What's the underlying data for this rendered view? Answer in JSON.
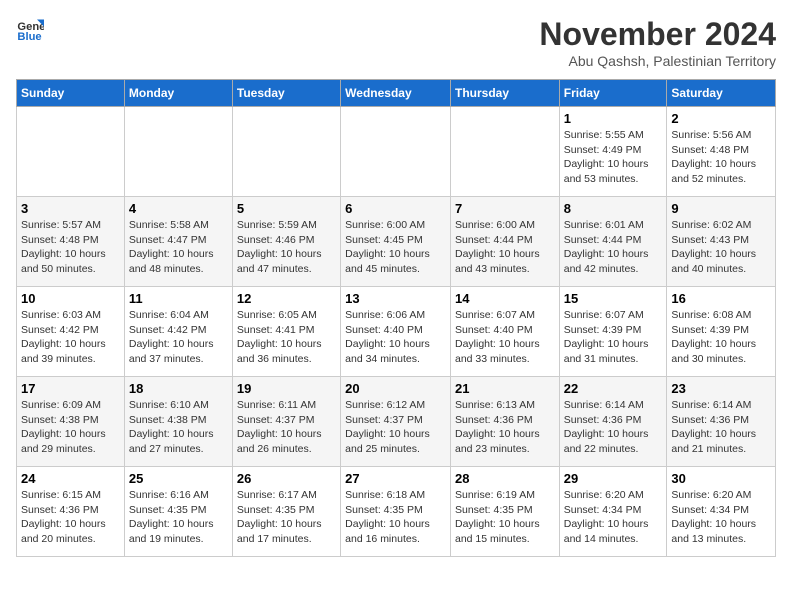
{
  "logo": {
    "text_general": "General",
    "text_blue": "Blue"
  },
  "header": {
    "month": "November 2024",
    "location": "Abu Qashsh, Palestinian Territory"
  },
  "weekdays": [
    "Sunday",
    "Monday",
    "Tuesday",
    "Wednesday",
    "Thursday",
    "Friday",
    "Saturday"
  ],
  "weeks": [
    [
      {
        "day": "",
        "info": ""
      },
      {
        "day": "",
        "info": ""
      },
      {
        "day": "",
        "info": ""
      },
      {
        "day": "",
        "info": ""
      },
      {
        "day": "",
        "info": ""
      },
      {
        "day": "1",
        "info": "Sunrise: 5:55 AM\nSunset: 4:49 PM\nDaylight: 10 hours and 53 minutes."
      },
      {
        "day": "2",
        "info": "Sunrise: 5:56 AM\nSunset: 4:48 PM\nDaylight: 10 hours and 52 minutes."
      }
    ],
    [
      {
        "day": "3",
        "info": "Sunrise: 5:57 AM\nSunset: 4:48 PM\nDaylight: 10 hours and 50 minutes."
      },
      {
        "day": "4",
        "info": "Sunrise: 5:58 AM\nSunset: 4:47 PM\nDaylight: 10 hours and 48 minutes."
      },
      {
        "day": "5",
        "info": "Sunrise: 5:59 AM\nSunset: 4:46 PM\nDaylight: 10 hours and 47 minutes."
      },
      {
        "day": "6",
        "info": "Sunrise: 6:00 AM\nSunset: 4:45 PM\nDaylight: 10 hours and 45 minutes."
      },
      {
        "day": "7",
        "info": "Sunrise: 6:00 AM\nSunset: 4:44 PM\nDaylight: 10 hours and 43 minutes."
      },
      {
        "day": "8",
        "info": "Sunrise: 6:01 AM\nSunset: 4:44 PM\nDaylight: 10 hours and 42 minutes."
      },
      {
        "day": "9",
        "info": "Sunrise: 6:02 AM\nSunset: 4:43 PM\nDaylight: 10 hours and 40 minutes."
      }
    ],
    [
      {
        "day": "10",
        "info": "Sunrise: 6:03 AM\nSunset: 4:42 PM\nDaylight: 10 hours and 39 minutes."
      },
      {
        "day": "11",
        "info": "Sunrise: 6:04 AM\nSunset: 4:42 PM\nDaylight: 10 hours and 37 minutes."
      },
      {
        "day": "12",
        "info": "Sunrise: 6:05 AM\nSunset: 4:41 PM\nDaylight: 10 hours and 36 minutes."
      },
      {
        "day": "13",
        "info": "Sunrise: 6:06 AM\nSunset: 4:40 PM\nDaylight: 10 hours and 34 minutes."
      },
      {
        "day": "14",
        "info": "Sunrise: 6:07 AM\nSunset: 4:40 PM\nDaylight: 10 hours and 33 minutes."
      },
      {
        "day": "15",
        "info": "Sunrise: 6:07 AM\nSunset: 4:39 PM\nDaylight: 10 hours and 31 minutes."
      },
      {
        "day": "16",
        "info": "Sunrise: 6:08 AM\nSunset: 4:39 PM\nDaylight: 10 hours and 30 minutes."
      }
    ],
    [
      {
        "day": "17",
        "info": "Sunrise: 6:09 AM\nSunset: 4:38 PM\nDaylight: 10 hours and 29 minutes."
      },
      {
        "day": "18",
        "info": "Sunrise: 6:10 AM\nSunset: 4:38 PM\nDaylight: 10 hours and 27 minutes."
      },
      {
        "day": "19",
        "info": "Sunrise: 6:11 AM\nSunset: 4:37 PM\nDaylight: 10 hours and 26 minutes."
      },
      {
        "day": "20",
        "info": "Sunrise: 6:12 AM\nSunset: 4:37 PM\nDaylight: 10 hours and 25 minutes."
      },
      {
        "day": "21",
        "info": "Sunrise: 6:13 AM\nSunset: 4:36 PM\nDaylight: 10 hours and 23 minutes."
      },
      {
        "day": "22",
        "info": "Sunrise: 6:14 AM\nSunset: 4:36 PM\nDaylight: 10 hours and 22 minutes."
      },
      {
        "day": "23",
        "info": "Sunrise: 6:14 AM\nSunset: 4:36 PM\nDaylight: 10 hours and 21 minutes."
      }
    ],
    [
      {
        "day": "24",
        "info": "Sunrise: 6:15 AM\nSunset: 4:36 PM\nDaylight: 10 hours and 20 minutes."
      },
      {
        "day": "25",
        "info": "Sunrise: 6:16 AM\nSunset: 4:35 PM\nDaylight: 10 hours and 19 minutes."
      },
      {
        "day": "26",
        "info": "Sunrise: 6:17 AM\nSunset: 4:35 PM\nDaylight: 10 hours and 17 minutes."
      },
      {
        "day": "27",
        "info": "Sunrise: 6:18 AM\nSunset: 4:35 PM\nDaylight: 10 hours and 16 minutes."
      },
      {
        "day": "28",
        "info": "Sunrise: 6:19 AM\nSunset: 4:35 PM\nDaylight: 10 hours and 15 minutes."
      },
      {
        "day": "29",
        "info": "Sunrise: 6:20 AM\nSunset: 4:34 PM\nDaylight: 10 hours and 14 minutes."
      },
      {
        "day": "30",
        "info": "Sunrise: 6:20 AM\nSunset: 4:34 PM\nDaylight: 10 hours and 13 minutes."
      }
    ]
  ]
}
